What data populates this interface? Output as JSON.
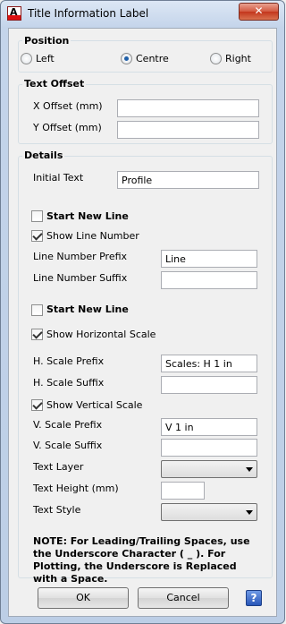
{
  "window": {
    "title": "Title Information Label",
    "close_glyph": "✕"
  },
  "position": {
    "title": "Position",
    "options": [
      {
        "label": "Left",
        "selected": false
      },
      {
        "label": "Centre",
        "selected": true
      },
      {
        "label": "Right",
        "selected": false
      }
    ]
  },
  "text_offset": {
    "title": "Text Offset",
    "x_label": "X Offset (mm)",
    "x_value": "",
    "y_label": "Y Offset (mm)",
    "y_value": ""
  },
  "details": {
    "title": "Details",
    "initial_text_label": "Initial Text",
    "initial_text_value": "Profile",
    "start_new_line_1": {
      "label": "Start New Line",
      "checked": false
    },
    "show_line_number": {
      "label": "Show Line Number",
      "checked": true
    },
    "line_number_prefix_label": "Line Number Prefix",
    "line_number_prefix_value": "Line",
    "line_number_suffix_label": "Line Number Suffix",
    "line_number_suffix_value": "",
    "start_new_line_2": {
      "label": "Start New Line",
      "checked": false
    },
    "show_horizontal_scale": {
      "label": "Show Horizontal Scale",
      "checked": true
    },
    "h_scale_prefix_label": "H. Scale Prefix",
    "h_scale_prefix_value": "Scales: H 1 in",
    "h_scale_suffix_label": "H. Scale Suffix",
    "h_scale_suffix_value": "",
    "show_vertical_scale": {
      "label": "Show Vertical Scale",
      "checked": true
    },
    "v_scale_prefix_label": "V. Scale Prefix",
    "v_scale_prefix_value": "V 1 in",
    "v_scale_suffix_label": "V. Scale Suffix",
    "v_scale_suffix_value": "",
    "text_layer_label": "Text Layer",
    "text_layer_value": "",
    "text_height_label": "Text Height (mm)",
    "text_height_value": "",
    "text_style_label": "Text Style",
    "text_style_value": ""
  },
  "note": "NOTE: For Leading/Trailing Spaces, use the Underscore Character ( _ ). For Plotting, the Underscore is Replaced with a Space.",
  "buttons": {
    "ok": "OK",
    "cancel": "Cancel",
    "help": "?"
  }
}
